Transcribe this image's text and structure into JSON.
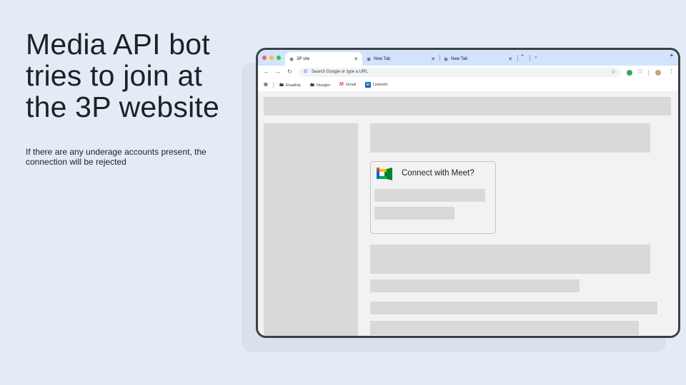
{
  "slide": {
    "title": "Media API bot tries to join at the 3P website",
    "subtitle": "If there are any underage accounts present, the connection will be rejected"
  },
  "browser": {
    "tabs": [
      {
        "label": "3P site",
        "active": true
      },
      {
        "label": "New Tab",
        "active": false
      },
      {
        "label": "New Tab",
        "active": false
      }
    ],
    "omnibox_placeholder": "Search Google or type a URL",
    "bookmarks": [
      {
        "label": "Roadtrip",
        "icon": "folder-icon"
      },
      {
        "label": "Noogler",
        "icon": "folder-icon"
      },
      {
        "label": "Gmail",
        "icon": "gmail-icon"
      },
      {
        "label": "LinkedIn",
        "icon": "linkedin-icon"
      }
    ]
  },
  "page": {
    "meet_prompt": "Connect with Meet?"
  },
  "colors": {
    "background": "#e3ecf6",
    "tabstrip": "#d3e3fd",
    "placeholder": "#d9d9d9",
    "page": "#f2f2f2"
  }
}
